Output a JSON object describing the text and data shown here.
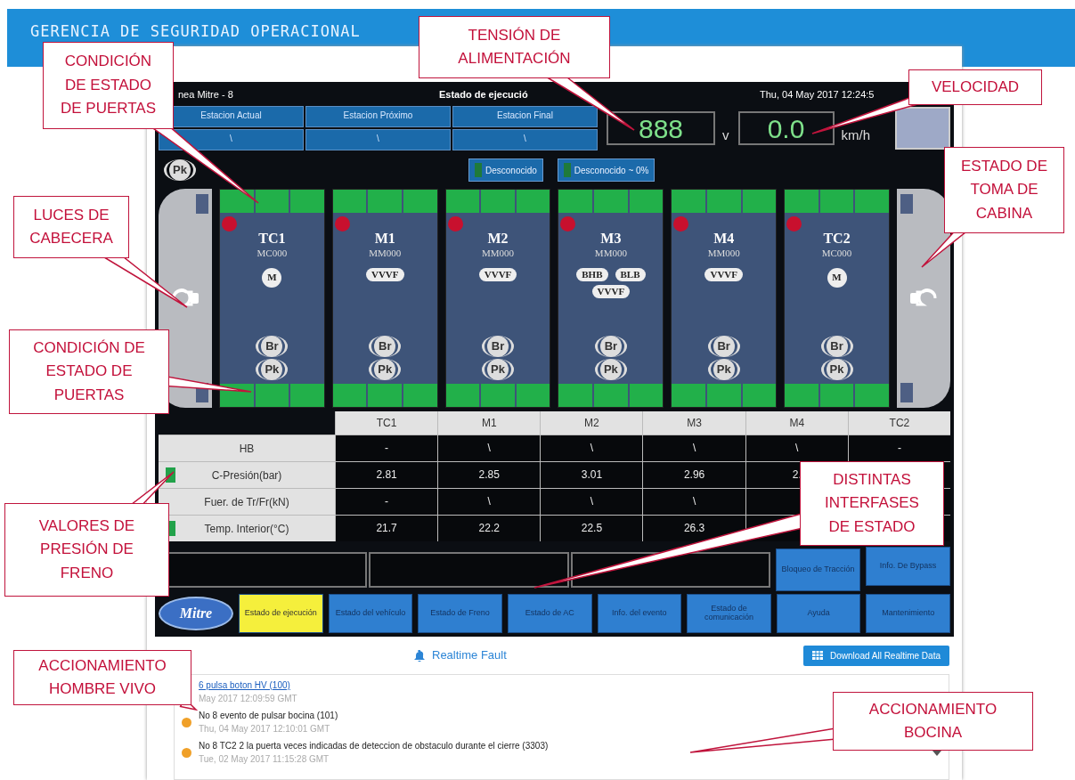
{
  "page_header": {
    "title": "GERENCIA DE SEGURIDAD OPERACIONAL"
  },
  "status_header": {
    "line": "nea Mitre - 8",
    "screen": "Estado de ejecució",
    "datetime": "Thu, 04 May 2017 12:24:5"
  },
  "stations": [
    {
      "label": "Estacion Actual",
      "value": "\\"
    },
    {
      "label": "Estacion Próximo",
      "value": "\\"
    },
    {
      "label": "Estacion Final",
      "value": "\\"
    }
  ],
  "voltage": {
    "value": "888",
    "unit": "v"
  },
  "speed": {
    "value": "0.0",
    "unit": "km/h"
  },
  "pk_indicator": "Pk",
  "status_chips": [
    {
      "label": "Desconocido"
    },
    {
      "label": "Desconocido ~ 0%"
    }
  ],
  "cars": [
    {
      "name": "TC1",
      "code": "MC000",
      "fault": true,
      "equipment_rows": [
        [
          {
            "label": "M",
            "kind": "circle"
          }
        ]
      ],
      "brake": "Br",
      "parking": "Pk"
    },
    {
      "name": "M1",
      "code": "MM000",
      "fault": true,
      "equipment_rows": [
        [
          {
            "label": "VVVF",
            "kind": "pill"
          }
        ]
      ],
      "brake": "Br",
      "parking": "Pk"
    },
    {
      "name": "M2",
      "code": "MM000",
      "fault": true,
      "equipment_rows": [
        [
          {
            "label": "VVVF",
            "kind": "pill"
          }
        ]
      ],
      "brake": "Br",
      "parking": "Pk"
    },
    {
      "name": "M3",
      "code": "MM000",
      "fault": true,
      "equipment_rows": [
        [
          {
            "label": "BHB",
            "kind": "pill"
          },
          {
            "label": "BLB",
            "kind": "pill"
          }
        ],
        [
          {
            "label": "VVVF",
            "kind": "pill"
          }
        ]
      ],
      "brake": "Br",
      "parking": "Pk"
    },
    {
      "name": "M4",
      "code": "MM000",
      "fault": true,
      "equipment_rows": [
        [
          {
            "label": "VVVF",
            "kind": "pill"
          }
        ]
      ],
      "brake": "Br",
      "parking": "Pk"
    },
    {
      "name": "TC2",
      "code": "MC000",
      "fault": true,
      "equipment_rows": [
        [
          {
            "label": "M",
            "kind": "circle"
          }
        ]
      ],
      "brake": "Br",
      "parking": "Pk"
    }
  ],
  "table": {
    "columns": [
      "TC1",
      "M1",
      "M2",
      "M3",
      "M4",
      "TC2"
    ],
    "rows": [
      {
        "label": "HB",
        "indicator": false,
        "cells": [
          "-",
          "\\",
          "\\",
          "\\",
          "\\",
          "-"
        ]
      },
      {
        "label": "C-Presión(bar)",
        "indicator": true,
        "cells": [
          "2.81",
          "2.85",
          "3.01",
          "2.96",
          "2.",
          null
        ]
      },
      {
        "label": "Fuer. de Tr/Fr(kN)",
        "indicator": false,
        "cells": [
          "-",
          "\\",
          "\\",
          "\\",
          null,
          null
        ]
      },
      {
        "label": "Temp. Interior(°C)",
        "indicator": true,
        "cells": [
          "21.7",
          "22.2",
          "22.5",
          "26.3",
          null,
          null
        ]
      }
    ]
  },
  "side_buttons": [
    "Bloqueo de Tracción",
    "Info. De Bypass"
  ],
  "nav": {
    "logo": "Mitre",
    "tabs": [
      {
        "label": "Estado de ejecución",
        "selected": true
      },
      {
        "label": "Estado del vehículo",
        "selected": false
      },
      {
        "label": "Estado de Freno",
        "selected": false
      },
      {
        "label": "Estado de AC",
        "selected": false
      },
      {
        "label": "Info. del evento",
        "selected": false
      },
      {
        "label": "Estado de comunicación",
        "selected": false
      },
      {
        "label": "Ayuda",
        "selected": false
      },
      {
        "label": "Mantenimiento",
        "selected": false
      }
    ]
  },
  "realtime_fault": {
    "title": "Realtime Fault",
    "download": "Download All Realtime Data",
    "items": [
      {
        "text": "6 pulsa boton HV (100)",
        "time": "May 2017 12:09:59 GMT",
        "link": true,
        "dot": false
      },
      {
        "text": "No 8 evento de pulsar bocina (101)",
        "time": "Thu, 04 May 2017 12:10:01 GMT",
        "link": false,
        "dot": true
      },
      {
        "text": "No 8 TC2 2 la puerta veces indicadas de deteccion de obstaculo durante el cierre (3303)",
        "time": "Tue, 02 May 2017 11:15:28 GMT",
        "link": false,
        "dot": true
      }
    ]
  },
  "callouts": [
    {
      "lines": [
        "CONDICIÓN",
        "DE ESTADO",
        "DE PUERTAS"
      ]
    },
    {
      "lines": [
        "TENSIÓN DE",
        "ALIMENTACIÓN"
      ]
    },
    {
      "lines": [
        "VELOCIDAD"
      ]
    },
    {
      "lines": [
        "ESTADO DE",
        "TOMA DE",
        "CABINA"
      ]
    },
    {
      "lines": [
        "LUCES DE",
        "CABECERA"
      ]
    },
    {
      "lines": [
        "CONDICIÓN DE",
        "ESTADO DE",
        "PUERTAS"
      ]
    },
    {
      "lines": [
        "VALORES DE",
        "PRESIÓN DE",
        "FRENO"
      ]
    },
    {
      "lines": [
        "DISTINTAS",
        "INTERFASES",
        "DE ESTADO"
      ]
    },
    {
      "lines": [
        "ACCIONAMIENTO",
        "HOMBRE VIVO"
      ]
    },
    {
      "lines": [
        "ACCIONAMIENTO",
        "BOCINA"
      ]
    }
  ]
}
